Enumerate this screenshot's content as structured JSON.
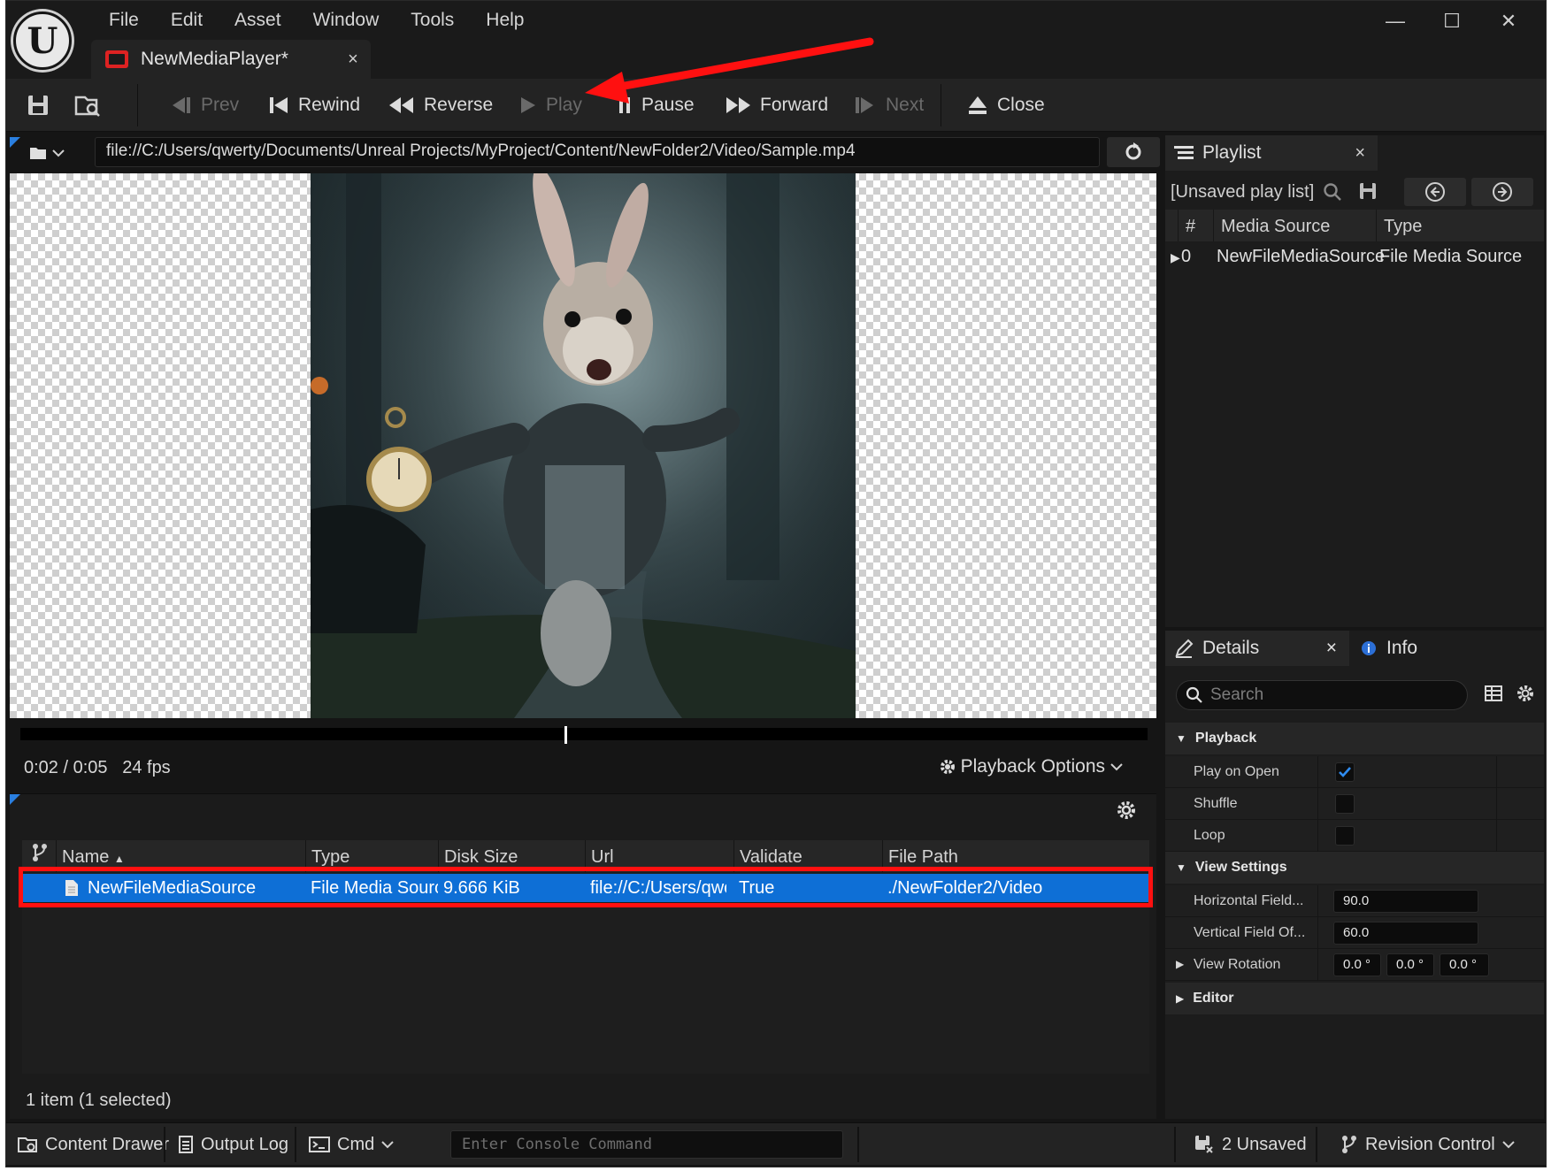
{
  "menu": [
    "File",
    "Edit",
    "Asset",
    "Window",
    "Tools",
    "Help"
  ],
  "document_tab": {
    "label": "NewMediaPlayer*",
    "close": "×"
  },
  "window_controls": {
    "minimize": "—",
    "maximize": "☐",
    "close": "✕"
  },
  "toolbar": {
    "prev": "Prev",
    "rewind": "Rewind",
    "reverse": "Reverse",
    "play": "Play",
    "pause": "Pause",
    "forward": "Forward",
    "next": "Next",
    "close": "Close"
  },
  "url": "file://C:/Users/qwerty/Documents/Unreal Projects/MyProject/Content/NewFolder2/Video/Sample.mp4",
  "playback": {
    "time": "0:02 / 0:05",
    "fps": "24 fps",
    "options_label": "Playback Options",
    "position_fraction": 0.483
  },
  "media_list": {
    "columns": [
      "Name",
      "Type",
      "Disk Size",
      "Url",
      "Validate",
      "File Path"
    ],
    "rows": [
      {
        "name": "NewFileMediaSource",
        "type": "File Media Source",
        "disk_size": "9.666 KiB",
        "url": "file://C:/Users/qwerty",
        "validate": "True",
        "file_path": "./NewFolder2/Video"
      }
    ],
    "count": "1 item (1 selected)"
  },
  "playlist": {
    "tab_label": "Playlist",
    "close": "×",
    "title": "[Unsaved play list]",
    "columns": [
      "#",
      "Media Source",
      "Type"
    ],
    "rows": [
      {
        "index": "0",
        "source": "NewFileMediaSource",
        "type": "File Media Source"
      }
    ]
  },
  "details": {
    "tab_label": "Details",
    "close": "×",
    "info_label": "Info",
    "search_placeholder": "Search",
    "categories": {
      "playback": "Playback",
      "view_settings": "View Settings",
      "editor": "Editor"
    },
    "props": {
      "play_on_open": "Play on Open",
      "shuffle": "Shuffle",
      "loop": "Loop",
      "horizontal_fov": "Horizontal Field...",
      "vertical_fov": "Vertical Field Of...",
      "view_rotation": "View Rotation"
    },
    "values": {
      "horizontal_fov": "90.0",
      "vertical_fov": "60.0",
      "rot_x": "0.0 °",
      "rot_y": "0.0 °",
      "rot_z": "0.0 °",
      "play_on_open_checked": true,
      "shuffle_checked": false,
      "loop_checked": false
    }
  },
  "statusbar": {
    "content_drawer": "Content Drawer",
    "output_log": "Output Log",
    "cmd": "Cmd",
    "console_placeholder": "Enter Console Command",
    "unsaved": "2 Unsaved",
    "revision_control": "Revision Control"
  },
  "colors": {
    "accent": "#0e6fd6",
    "highlight": "#ff1010",
    "annotation_arrow": "#ff1010"
  }
}
